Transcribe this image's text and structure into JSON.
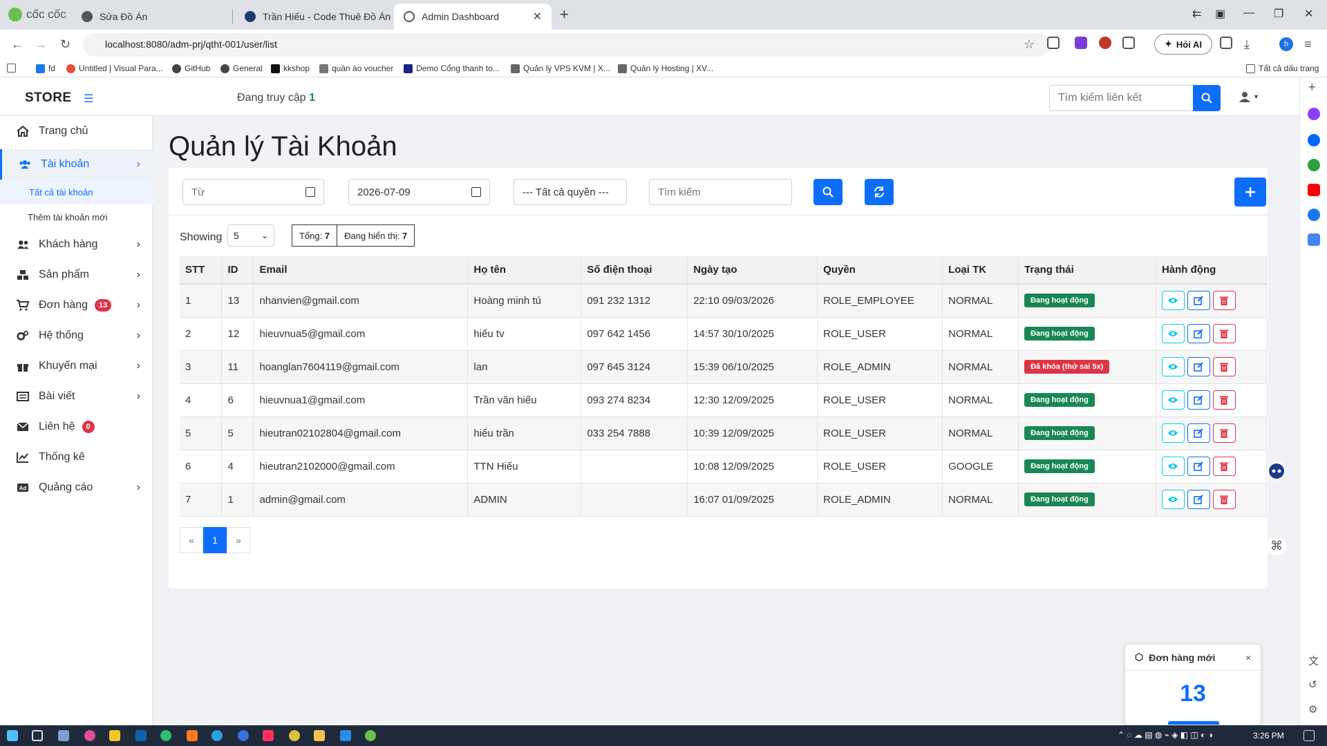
{
  "browser": {
    "brand": "cốc cốc",
    "tabs": [
      {
        "title": "Sửa Đồ Án"
      },
      {
        "title": "Trần Hiếu - Code Thuê Đồ Án - J"
      },
      {
        "title": "Admin Dashboard",
        "active": true
      }
    ],
    "url": "localhost:8080/adm-prj/qtht-001/user/list",
    "ai_button": "Hỏi AI",
    "profile_initial": "h",
    "bookmarks": [
      "fd",
      "Untitled | Visual Para...",
      "GitHub",
      "General",
      "kkshop",
      "quần áo voucher",
      "Demo Cổng thanh to...",
      "Quản lý VPS KVM | X...",
      "Quản lý Hosting | XV..."
    ],
    "all_bookmarks": "Tất cả dấu trang"
  },
  "app": {
    "brand": "STORE",
    "online_label": "Đang truy cập",
    "online_count": "1",
    "search_placeholder": "Tìm kiếm liên kết"
  },
  "sidebar": {
    "items": [
      {
        "label": "Trang chủ",
        "icon": "home-icon"
      },
      {
        "label": "Tài khoản",
        "icon": "users-icon",
        "active": true
      },
      {
        "label": "Khách hàng",
        "icon": "customers-icon"
      },
      {
        "label": "Sản phẩm",
        "icon": "products-icon"
      },
      {
        "label": "Đơn hàng",
        "icon": "cart-icon",
        "badge": "13"
      },
      {
        "label": "Hệ thống",
        "icon": "gears-icon"
      },
      {
        "label": "Khuyến mại",
        "icon": "gift-icon"
      },
      {
        "label": "Bài viết",
        "icon": "article-icon"
      },
      {
        "label": "Liên hệ",
        "icon": "envelope-icon",
        "badge": "0"
      },
      {
        "label": "Thống kê",
        "icon": "chart-icon"
      },
      {
        "label": "Quảng cáo",
        "icon": "ad-icon"
      }
    ],
    "sub_items": [
      "Tất cả tài khoản",
      "Thêm tài khoản mới"
    ]
  },
  "page": {
    "title": "Quản lý Tài Khoản",
    "filters": {
      "from_placeholder": "Từ",
      "to_value": "2026-07-09",
      "role_select": "--- Tất cả quyền ---",
      "search_placeholder": "Tìm kiếm"
    },
    "showing_label": "Showing",
    "per_page": "5",
    "total_label": "Tổng:",
    "total_value": "7",
    "displayed_label": "Đang hiển thị:",
    "displayed_value": "7",
    "columns": [
      "STT",
      "ID",
      "Email",
      "Họ tên",
      "Số điện thoại",
      "Ngày tạo",
      "Quyền",
      "Loại TK",
      "Trạng thái",
      "Hành động"
    ],
    "rows": [
      {
        "stt": "1",
        "id": "13",
        "email": "nhanvien@gmail.com",
        "name": "Hoàng minh tú",
        "phone": "091 232 1312",
        "created": "22:10 09/03/2026",
        "role": "ROLE_EMPLOYEE",
        "type": "NORMAL",
        "status": "Đang hoạt động",
        "status_kind": "on"
      },
      {
        "stt": "2",
        "id": "12",
        "email": "hieuvnua5@gmail.com",
        "name": "hiếu tv",
        "phone": "097 642 1456",
        "created": "14:57 30/10/2025",
        "role": "ROLE_USER",
        "type": "NORMAL",
        "status": "Đang hoạt động",
        "status_kind": "on"
      },
      {
        "stt": "3",
        "id": "11",
        "email": "hoanglan7604119@gmail.com",
        "name": "lan",
        "phone": "097 645 3124",
        "created": "15:39 06/10/2025",
        "role": "ROLE_ADMIN",
        "type": "NORMAL",
        "status": "Đã khóa (thử sai 5x)",
        "status_kind": "locked"
      },
      {
        "stt": "4",
        "id": "6",
        "email": "hieuvnua1@gmail.com",
        "name": "Trần văn hiếu",
        "phone": "093 274 8234",
        "created": "12:30 12/09/2025",
        "role": "ROLE_USER",
        "type": "NORMAL",
        "status": "Đang hoạt động",
        "status_kind": "on"
      },
      {
        "stt": "5",
        "id": "5",
        "email": "hieutran02102804@gmail.com",
        "name": "hiếu trần",
        "phone": "033 254 7888",
        "created": "10:39 12/09/2025",
        "role": "ROLE_USER",
        "type": "NORMAL",
        "status": "Đang hoạt động",
        "status_kind": "on"
      },
      {
        "stt": "6",
        "id": "4",
        "email": "hieutran2102000@gmail.com",
        "name": "TTN Hiếu",
        "phone": "",
        "created": "10:08 12/09/2025",
        "role": "ROLE_USER",
        "type": "GOOGLE",
        "status": "Đang hoạt động",
        "status_kind": "on"
      },
      {
        "stt": "7",
        "id": "1",
        "email": "admin@gmail.com",
        "name": "ADMIN",
        "phone": "",
        "created": "16:07 01/09/2025",
        "role": "ROLE_ADMIN",
        "type": "NORMAL",
        "status": "Đang hoạt động",
        "status_kind": "on"
      }
    ],
    "pagination": {
      "prev": "«",
      "current": "1",
      "next": "»"
    }
  },
  "toast": {
    "title": "Đơn hàng mới",
    "close": "×",
    "count": "13"
  },
  "taskbar": {
    "time": "3:26 PM"
  },
  "colors": {
    "primary": "#0d6efd",
    "success": "#198754",
    "danger": "#dc3545",
    "info": "#0dcaf0"
  }
}
